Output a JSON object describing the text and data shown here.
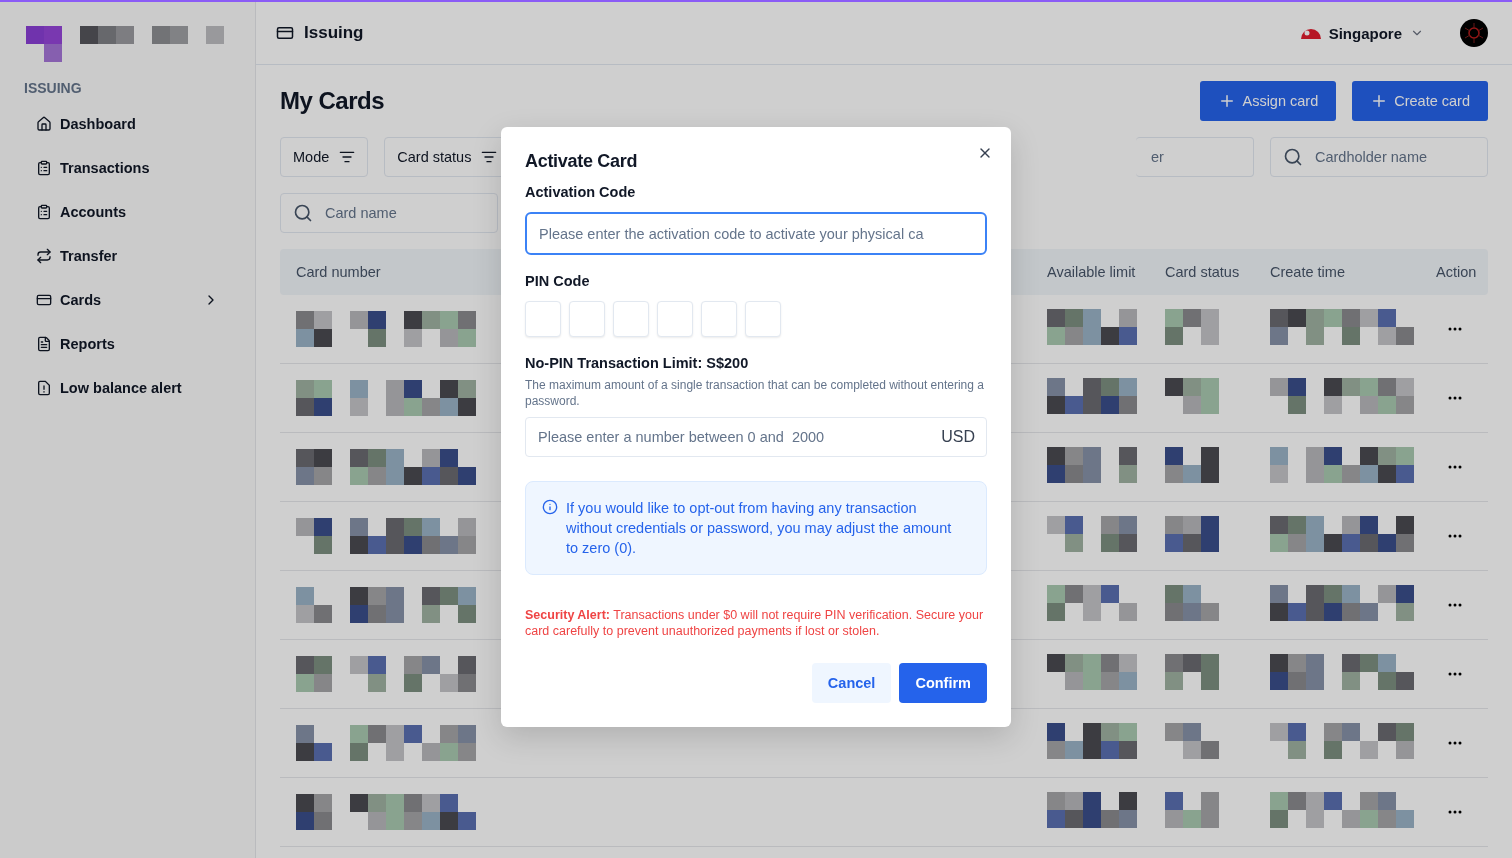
{
  "sidebar": {
    "section": "ISSUING",
    "items": [
      {
        "label": "Dashboard",
        "kind": "home",
        "selected": false
      },
      {
        "label": "Transactions",
        "kind": "list",
        "selected": false
      },
      {
        "label": "Accounts",
        "kind": "clipboard",
        "selected": false
      },
      {
        "label": "Transfer",
        "kind": "transfer",
        "selected": false
      },
      {
        "label": "Cards",
        "kind": "card",
        "selected": false,
        "expandable": true
      },
      {
        "label": "Reports",
        "kind": "report",
        "selected": false
      },
      {
        "label": "Low balance alert",
        "kind": "alert",
        "selected": false
      }
    ]
  },
  "topbar": {
    "title": "Issuing",
    "region": "Singapore"
  },
  "page": {
    "title": "My Cards",
    "actions": [
      "Assign card",
      "Create card"
    ]
  },
  "filter_rows": [
    {
      "items": [
        {
          "kind": "filter",
          "label": "Mode"
        },
        {
          "kind": "filter",
          "label": "Card status"
        },
        {
          "kind": "partial",
          "placeholder": "er"
        },
        {
          "kind": "search",
          "placeholder": "Cardholder name"
        }
      ]
    },
    {
      "items": [
        {
          "kind": "search",
          "placeholder": "Card name"
        }
      ]
    }
  ],
  "table": {
    "columns": [
      "Card number",
      "Available limit",
      "Card status",
      "Create time",
      "Action"
    ],
    "rows": [
      {
        "kind": "picture"
      },
      {
        "kind": "picture"
      },
      {
        "kind": "picture"
      },
      {
        "kind": "picture"
      },
      {
        "kind": "picture"
      },
      {
        "kind": "picture"
      },
      {
        "kind": "picture"
      },
      {
        "kind": "picture"
      }
    ]
  },
  "dialog": {
    "title": "Activate Card",
    "activation": {
      "label": "Activation Code",
      "placeholder": "Please enter the activation code to activate your physical ca",
      "focused": true
    },
    "pin": {
      "label": "PIN Code",
      "boxes": [
        {
          "filled": false
        },
        {
          "filled": false
        },
        {
          "filled": false
        },
        {
          "filled": false
        },
        {
          "filled": false
        },
        {
          "filled": false
        }
      ]
    },
    "limit": {
      "title": "No-PIN Transaction Limit: S$200",
      "description": "The maximum amount of a single transaction that can be completed without entering a password.",
      "placeholder": "Please enter a number between 0 and  2000",
      "suffix": "USD"
    },
    "info": "If you would like to opt-out from having any transaction without credentials or password, you may adjust the amount to zero (0).",
    "alert": "**Security Alert:** Transactions under $0 will not require PIN verification. Secure your card carefully to prevent unauthorized payments if lost or stolen.",
    "buttons": [
      {
        "label": "Cancel",
        "kind": "secondary"
      },
      {
        "label": "Confirm",
        "kind": "primary"
      }
    ]
  }
}
